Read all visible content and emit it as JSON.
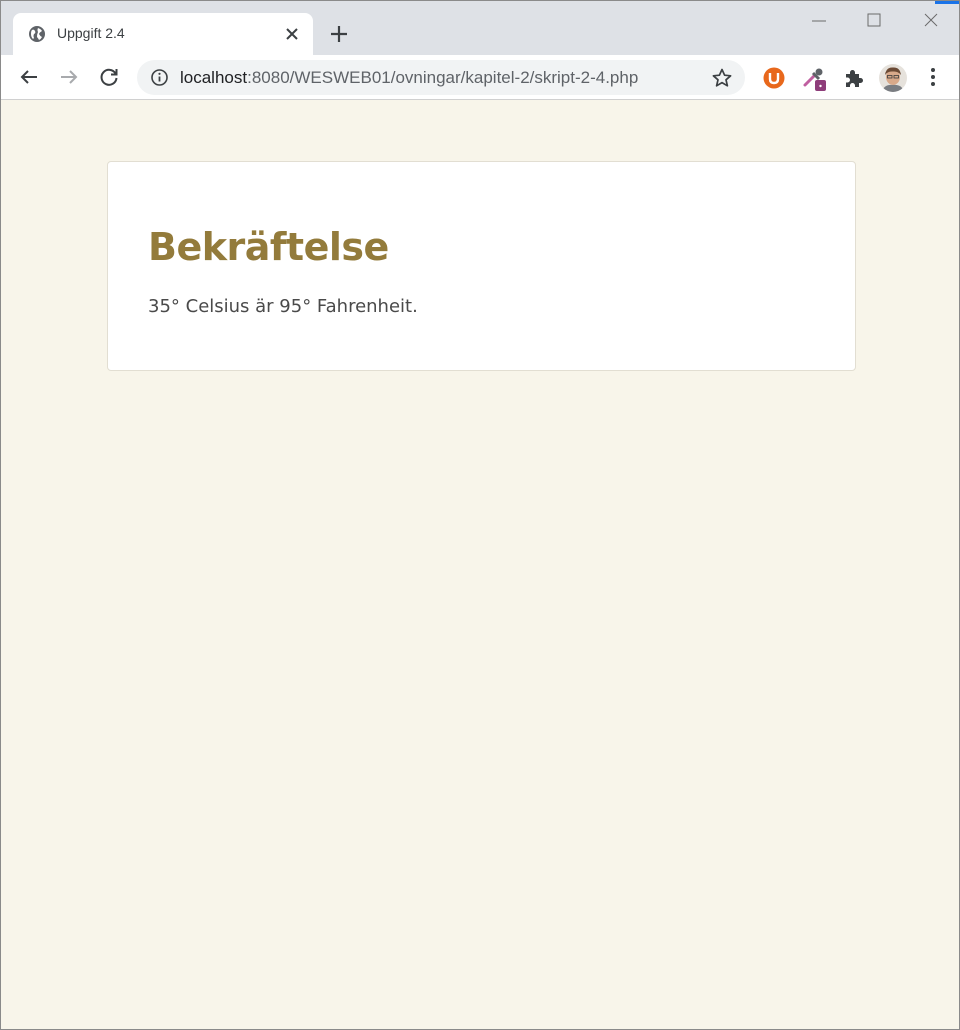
{
  "browser": {
    "tab": {
      "title": "Uppgift 2.4",
      "favicon": "globe-icon"
    },
    "address_bar": {
      "url_host": "localhost",
      "url_path": ":8080/WESWEB01/ovningar/kapitel-2/skript-2-4.php"
    },
    "extensions": [
      "ublock-icon",
      "color-picker-icon",
      "puzzle-icon"
    ]
  },
  "page": {
    "heading": "Bekräftelse",
    "message": "35° Celsius är 95° Fahrenheit."
  },
  "colors": {
    "page_background": "#f8f5ea",
    "heading": "#937b3b",
    "card_background": "#ffffff",
    "chrome_frame": "#dee1e6"
  }
}
